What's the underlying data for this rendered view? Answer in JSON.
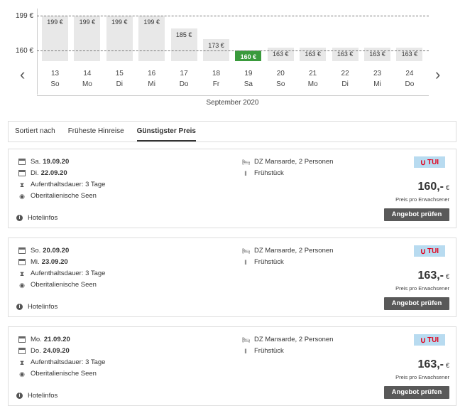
{
  "chart_data": {
    "type": "bar",
    "y_ticks": [
      "199 €",
      "160 €"
    ],
    "y_tick_values": [
      199,
      160
    ],
    "ylim": [
      145,
      199
    ],
    "currency": "€",
    "month_label": "September 2020",
    "selected_index": 6,
    "points": [
      {
        "day": "13",
        "weekday": "So",
        "value": 199,
        "label": "199 €"
      },
      {
        "day": "14",
        "weekday": "Mo",
        "value": 199,
        "label": "199 €"
      },
      {
        "day": "15",
        "weekday": "Di",
        "value": 199,
        "label": "199 €"
      },
      {
        "day": "16",
        "weekday": "Mi",
        "value": 199,
        "label": "199 €"
      },
      {
        "day": "17",
        "weekday": "Do",
        "value": 185,
        "label": "185 €"
      },
      {
        "day": "18",
        "weekday": "Fr",
        "value": 173,
        "label": "173 €"
      },
      {
        "day": "19",
        "weekday": "Sa",
        "value": 160,
        "label": "160 €"
      },
      {
        "day": "20",
        "weekday": "So",
        "value": 163,
        "label": "163 €"
      },
      {
        "day": "21",
        "weekday": "Mo",
        "value": 163,
        "label": "163 €"
      },
      {
        "day": "22",
        "weekday": "Di",
        "value": 163,
        "label": "163 €"
      },
      {
        "day": "23",
        "weekday": "Mi",
        "value": 163,
        "label": "163 €"
      },
      {
        "day": "24",
        "weekday": "Do",
        "value": 163,
        "label": "163 €"
      }
    ],
    "colors": {
      "bar": "#e8e8e8",
      "selected": "#3a9a3c"
    }
  },
  "nav": {
    "prev_icon": "chevron-left-icon",
    "next_icon": "chevron-right-icon"
  },
  "sort": {
    "label": "Sortiert nach",
    "options": [
      "Früheste Hinreise",
      "Günstigster Preis"
    ],
    "active": "Günstigster Preis"
  },
  "offers": [
    {
      "out_day": "Sa.",
      "out_date": "19.09.20",
      "ret_day": "Di.",
      "ret_date": "22.09.20",
      "duration": "Aufenthaltsdauer: 3 Tage",
      "region": "Oberitalienische Seen",
      "room": "DZ Mansarde, 2 Personen",
      "board": "Frühstück",
      "operator": "TUI",
      "price": "160,-",
      "currency": "€",
      "price_note": "Preis pro Erwachsener",
      "cta": "Angebot prüfen",
      "info": "Hotelinfos"
    },
    {
      "out_day": "So.",
      "out_date": "20.09.20",
      "ret_day": "Mi.",
      "ret_date": "23.09.20",
      "duration": "Aufenthaltsdauer: 3 Tage",
      "region": "Oberitalienische Seen",
      "room": "DZ Mansarde, 2 Personen",
      "board": "Frühstück",
      "operator": "TUI",
      "price": "163,-",
      "currency": "€",
      "price_note": "Preis pro Erwachsener",
      "cta": "Angebot prüfen",
      "info": "Hotelinfos"
    },
    {
      "out_day": "Mo.",
      "out_date": "21.09.20",
      "ret_day": "Do.",
      "ret_date": "24.09.20",
      "duration": "Aufenthaltsdauer: 3 Tage",
      "region": "Oberitalienische Seen",
      "room": "DZ Mansarde, 2 Personen",
      "board": "Frühstück",
      "operator": "TUI",
      "price": "163,-",
      "currency": "€",
      "price_note": "Preis pro Erwachsener",
      "cta": "Angebot prüfen",
      "info": "Hotelinfos"
    }
  ]
}
